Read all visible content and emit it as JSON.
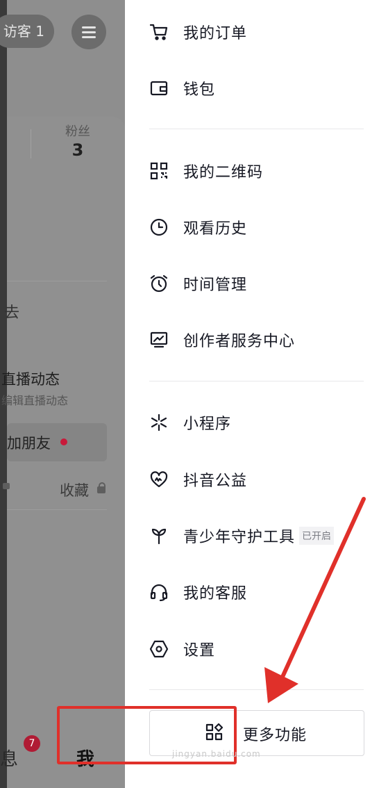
{
  "background_page": {
    "visitor_text": "访客 1",
    "fans_label": "粉丝",
    "fans_count": "3",
    "partial_char": "去",
    "live_title": "直播动态",
    "live_subtitle": "编辑直播动态",
    "add_friend": "加朋友",
    "collect_label": "收藏",
    "tab_messages": "息",
    "tab_me": "我",
    "message_badge": "7"
  },
  "drawer": {
    "groups": [
      [
        {
          "label": "我的订单",
          "icon": "cart-icon"
        },
        {
          "label": "钱包",
          "icon": "wallet-icon"
        }
      ],
      [
        {
          "label": "我的二维码",
          "icon": "qrcode-icon"
        },
        {
          "label": "观看历史",
          "icon": "clock-icon"
        },
        {
          "label": "时间管理",
          "icon": "alarm-icon"
        },
        {
          "label": "创作者服务中心",
          "icon": "chart-monitor-icon"
        }
      ],
      [
        {
          "label": "小程序",
          "icon": "mini-program-icon"
        },
        {
          "label": "抖音公益",
          "icon": "charity-heart-icon"
        },
        {
          "label": "青少年守护工具",
          "icon": "sprout-icon",
          "tag": "已开启"
        },
        {
          "label": "我的客服",
          "icon": "headset-icon"
        },
        {
          "label": "设置",
          "icon": "settings-hexagon-icon"
        }
      ]
    ],
    "more_button": {
      "label": "更多功能",
      "icon": "grid-icon"
    }
  },
  "annotation": {
    "highlight_color": "#e0302a"
  },
  "watermark": "jingyan.baidu.com"
}
